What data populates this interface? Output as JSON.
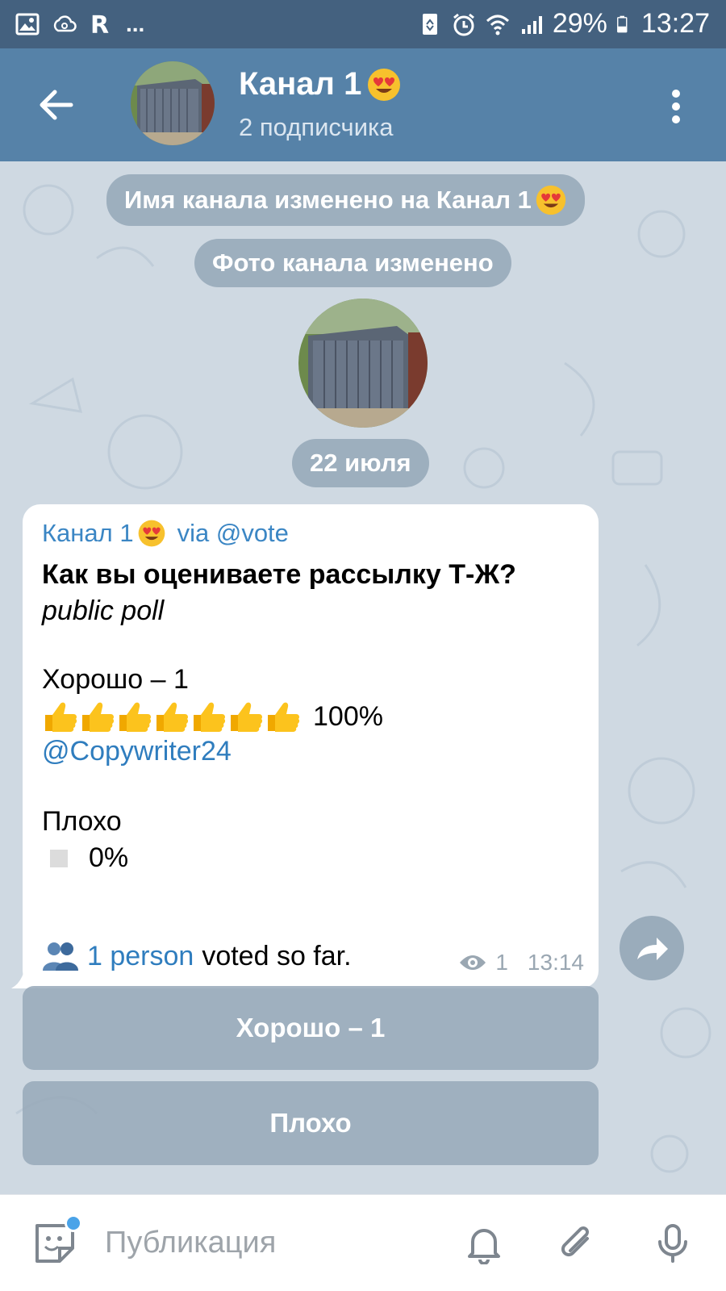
{
  "status_bar": {
    "battery": "29%",
    "time": "13:27",
    "ellipsis": "..."
  },
  "header": {
    "title": "Канал 1",
    "subtitle": "2 подписчика"
  },
  "service_messages": {
    "name_changed": "Имя канала изменено на Канал 1",
    "photo_changed": "Фото канала изменено",
    "date": "22 июля"
  },
  "message": {
    "author": "Канал 1",
    "via": "via @vote",
    "question": "Как вы оцениваете рассылку Т-Ж?",
    "poll_type": "public poll",
    "option1": "Хорошо – 1",
    "option1_percent": "100%",
    "option1_voter": "@Copywriter24",
    "option2": "Плохо",
    "option2_percent": "0%",
    "voters_count": "1 person",
    "voters_suffix": "voted so far.",
    "views": "1",
    "time": "13:14"
  },
  "buttons": {
    "option1": "Хорошо – 1",
    "option2": "Плохо"
  },
  "input": {
    "placeholder": "Публикация"
  },
  "colors": {
    "header": "#5682a8",
    "statusbar": "#44617f",
    "link": "#2f7dbe"
  }
}
